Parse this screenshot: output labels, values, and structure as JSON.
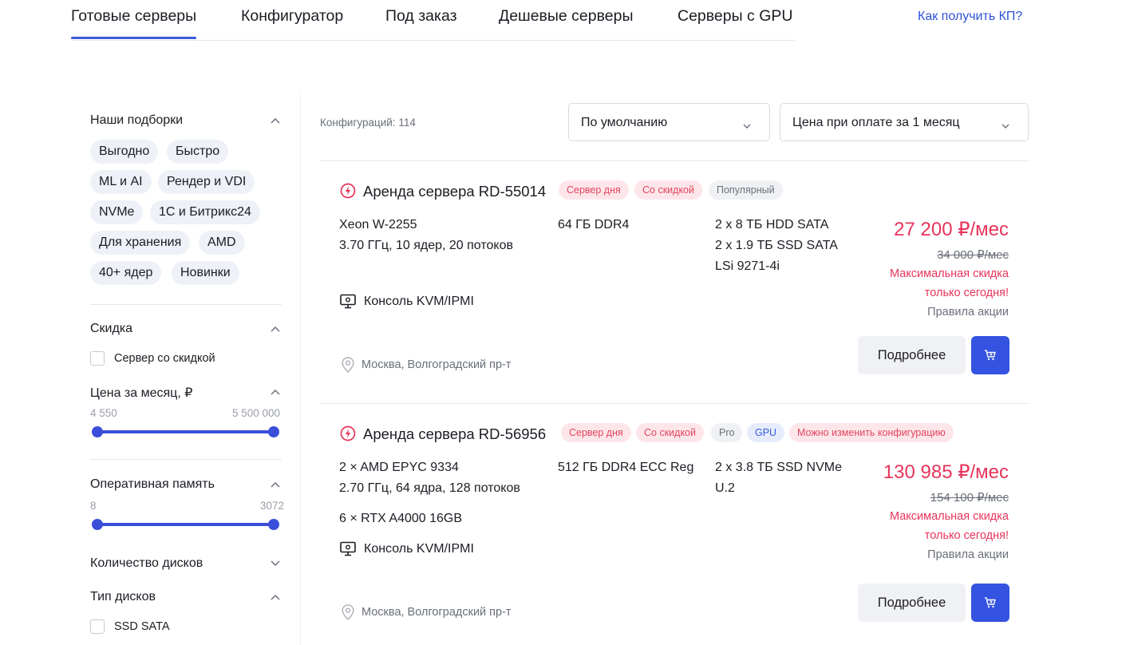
{
  "nav": {
    "tabs": [
      {
        "label": "Готовые серверы"
      },
      {
        "label": "Конфигуратор"
      },
      {
        "label": "Под заказ"
      },
      {
        "label": "Дешевые серверы"
      },
      {
        "label": "Серверы с GPU"
      }
    ],
    "kp_link": "Как получить КП?"
  },
  "sidebar": {
    "collections": {
      "title": "Наши подборки",
      "pills": [
        "Выгодно",
        "Быстро",
        "ML и AI",
        "Рендер и VDI",
        "NVMe",
        "1С и Битрикс24",
        "Для хранения",
        "AMD",
        "40+ ядер",
        "Новинки"
      ]
    },
    "discount": {
      "title": "Скидка",
      "checkbox": "Сервер со скидкой"
    },
    "price": {
      "title": "Цена за месяц, ₽",
      "min": "4 550",
      "max": "5 500 000"
    },
    "ram": {
      "title": "Оперативная память",
      "min": "8",
      "max": "3072"
    },
    "disk_count": {
      "title": "Количество дисков"
    },
    "disk_type": {
      "title": "Тип дисков",
      "checkbox": "SSD SATA"
    }
  },
  "main": {
    "count": "Конфигураций: 114",
    "sort": "По умолчанию",
    "period": "Цена при оплате за 1 месяц"
  },
  "cards": [
    {
      "title": "Аренда сервера RD-55014",
      "badges": [
        "Сервер дня",
        "Со скидкой",
        "Популярный"
      ],
      "cpu1": "Xeon W-2255",
      "cpu2": "3.70 ГГц, 10 ядер, 20 потоков",
      "ram": "64 ГБ DDR4",
      "disk1": "2 x 8 ТБ HDD SATA",
      "disk2": "2 x 1.9 ТБ SSD SATA",
      "disk3": "LSi 9271-4i",
      "kvm": "Консоль KVM/IPMI",
      "location": "Москва, Волгоградский пр-т",
      "price": "27 200 ₽/мес",
      "old_price": "34 000 ₽/мес",
      "promo1": "Максимальная скидка",
      "promo2": "только сегодня!",
      "rules": "Правила акции",
      "more": "Подробнее"
    },
    {
      "title": "Аренда сервера RD-56956",
      "badges": [
        "Сервер дня",
        "Со скидкой",
        "Pro",
        "GPU",
        "Можно изменить конфигурацию"
      ],
      "cpu1": "2 × AMD EPYC 9334",
      "cpu2": "2.70 ГГц, 64 ядра, 128 потоков",
      "gpu": "6 × RTX A4000 16GB",
      "ram": "512 ГБ DDR4 ECC Reg",
      "disk1": "2 x 3.8 ТБ SSD NVMe",
      "disk2": "U.2",
      "kvm": "Консоль KVM/IPMI",
      "location": "Москва, Волгоградский пр-т",
      "price": "130 985 ₽/мес",
      "old_price": "154 100 ₽/мес",
      "promo1": "Максимальная скидка",
      "promo2": "только сегодня!",
      "rules": "Правила акции",
      "more": "Подробнее"
    }
  ]
}
